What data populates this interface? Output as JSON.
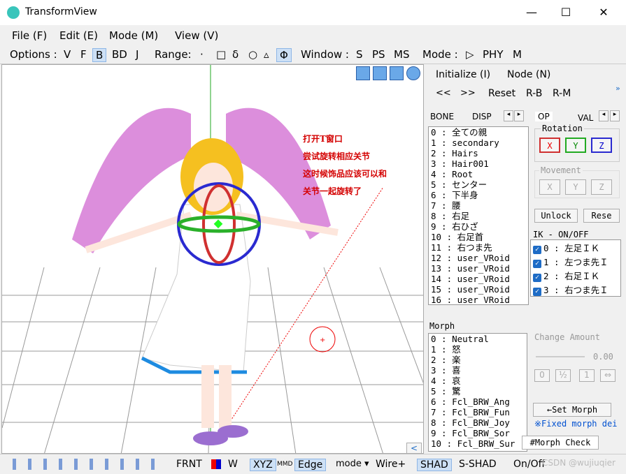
{
  "window": {
    "title": "TransformView",
    "minimize": "—",
    "maximize": "☐",
    "close": "✕"
  },
  "menu": [
    "File (F)",
    "Edit (E)",
    "Mode (M)",
    "View (V)"
  ],
  "toolbar": {
    "options_label": "Options :",
    "options": [
      "V",
      "F",
      "B",
      "BD",
      "J"
    ],
    "range_label": "Range:",
    "range": [
      "·",
      "□",
      "δ",
      "○",
      "▵",
      "Φ"
    ],
    "window_label": "Window :",
    "windows": [
      "S",
      "PS",
      "MS"
    ],
    "mode_label": "Mode :",
    "modes": [
      "▷",
      "PHY",
      "M"
    ]
  },
  "annotation": [
    "打开T窗口",
    "尝试旋转相应关节",
    "这时候饰品应该可以和",
    "关节一起旋转了"
  ],
  "panel": {
    "initialize": "Initialize (I)",
    "node": "Node (N)",
    "prev": "<<",
    "next": ">>",
    "reset": "Reset",
    "rb": "R-B",
    "rm": "R-M",
    "tabs": {
      "bone": "BONE",
      "disp": "DISP",
      "op": "OP",
      "val": "VAL"
    },
    "bones": [
      "0 : 全ての親",
      "1 : secondary",
      "2 : Hairs",
      "3 : Hair001",
      "4 : Root",
      "5 : センター",
      "6 : 下半身",
      "7 : 腰",
      "8 : 右足",
      "9 : 右ひざ",
      "10 : 右足首",
      "11 : 右つま先",
      "12 : user_VRoid",
      "13 : user_VRoid",
      "14 : user_VRoid",
      "15 : user_VRoid",
      "16 : user_VRoid"
    ],
    "rotation_label": "Rotation",
    "rotation": [
      "X",
      "Y",
      "Z"
    ],
    "movement_label": "Movement",
    "movement": [
      "X",
      "Y",
      "Z"
    ],
    "unlock": "Unlock",
    "reset2": "Rese",
    "ik_label": "IK - ON/OFF",
    "ik": [
      "0 : 左足ＩＫ",
      "1 : 左つま先Ｉ",
      "2 : 右足ＩＫ",
      "3 : 右つま先Ｉ"
    ],
    "morph_label": "Morph",
    "morphs": [
      "0 : Neutral",
      "1 : 怒",
      "2 : 楽",
      "3 : 喜",
      "4 : 哀",
      "5 : 驚",
      "6 : Fcl_BRW_Ang",
      "7 : Fcl_BRW_Fun",
      "8 : Fcl_BRW_Joy",
      "9 : Fcl_BRW_Sor",
      "10 : Fcl_BRW_Sur"
    ],
    "change_amount_label": "Change Amount",
    "change_amount_value": "0.00",
    "amount_buttons": [
      "0",
      "½",
      "1",
      "⇔"
    ],
    "set_morph": "←Set Morph",
    "fixed_morph": "※Fixed morph dei",
    "morph_check": "#Morph Check"
  },
  "statusbar": {
    "frnt": "FRNT",
    "w": "W",
    "xyz": "XYZ",
    "mmd": "MMD",
    "edge": "Edge",
    "mode": "mode ▾",
    "wire": "Wire+",
    "shad": "SHAD",
    "sshad": "S-SHAD",
    "onoff": "On/Off",
    "watermark": "CSDN @wujiuqier"
  },
  "colors": {
    "accent": "#cde0f5",
    "rot_x": "#e00000",
    "rot_y": "#00a000",
    "rot_z": "#0000e0",
    "wing": "#d67ad6"
  }
}
